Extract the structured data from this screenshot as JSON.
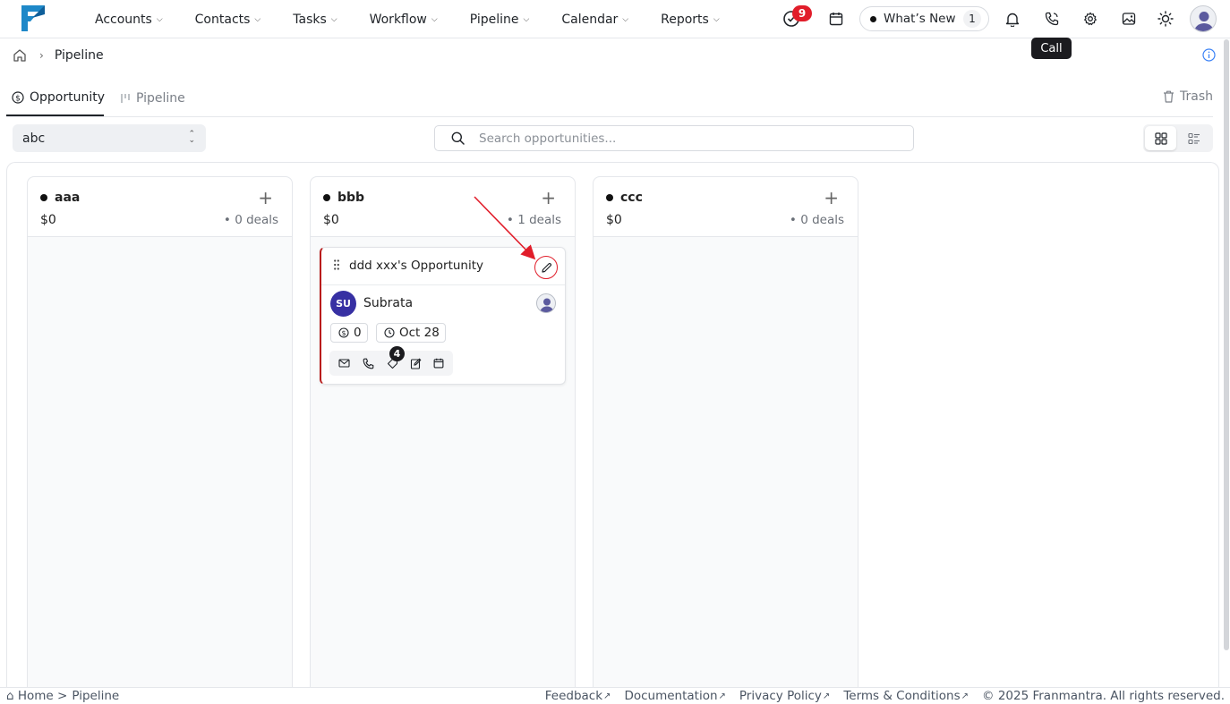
{
  "header": {
    "nav": [
      {
        "label": "Accounts"
      },
      {
        "label": "Contacts"
      },
      {
        "label": "Tasks"
      },
      {
        "label": "Workflow"
      },
      {
        "label": "Pipeline"
      },
      {
        "label": "Calendar"
      },
      {
        "label": "Reports"
      }
    ],
    "tasks_badge": "9",
    "whats_new_label": "What’s New",
    "whats_new_count": "1",
    "tooltip": "Call"
  },
  "breadcrumb": {
    "current": "Pipeline"
  },
  "tabs": [
    {
      "label": "Opportunity",
      "active": true
    },
    {
      "label": "Pipeline",
      "active": false
    }
  ],
  "trash_label": "Trash",
  "pipeline_select": {
    "value": "abc"
  },
  "search": {
    "placeholder": "Search opportunities..."
  },
  "columns": [
    {
      "name": "aaa",
      "amount": "$0",
      "deals": "0 deals"
    },
    {
      "name": "bbb",
      "amount": "$0",
      "deals": "1 deals"
    },
    {
      "name": "ccc",
      "amount": "$0",
      "deals": "0 deals"
    }
  ],
  "card": {
    "title": "ddd xxx's Opportunity",
    "owner_initials": "SU",
    "owner_name": "Subrata",
    "value": "0",
    "date": "Oct 28",
    "tag_count": "4"
  },
  "footer": {
    "home": "⌂ Home >",
    "current": "Pipeline",
    "links": [
      "Feedback",
      "Documentation",
      "Privacy Policy",
      "Terms & Conditions"
    ],
    "copyright": "© 2025 Franmantra. All rights reserved."
  },
  "colors": {
    "accent": "#1e88c8",
    "danger": "#e11d2a",
    "owner_avatar": "#3730a3"
  },
  "icons": [
    "logo",
    "tasks-icon",
    "calendar-icon",
    "bell-icon",
    "phone-icon",
    "gear-icon",
    "image-icon",
    "sun-icon",
    "user-avatar-icon",
    "home-icon",
    "info-icon",
    "dollar-icon",
    "pipeline-icon",
    "trash-icon",
    "search-icon",
    "grid-view-icon",
    "list-view-icon",
    "plus-icon",
    "drag-handle-icon",
    "edit-icon",
    "clock-icon",
    "mail-icon",
    "tag-icon",
    "note-icon"
  ]
}
